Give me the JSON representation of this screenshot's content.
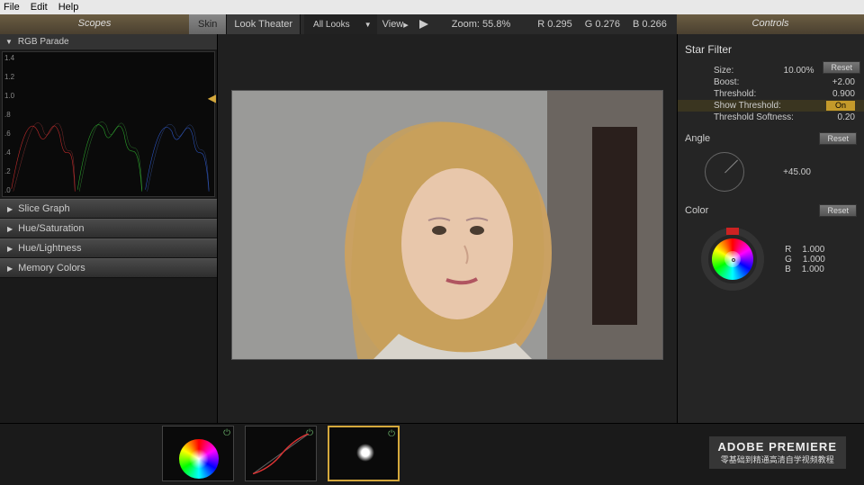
{
  "menu": {
    "file": "File",
    "edit": "Edit",
    "help": "Help"
  },
  "panels": {
    "scopes": "Scopes",
    "controls": "Controls"
  },
  "toolbar": {
    "skin": "Skin",
    "look_theater": "Look Theater",
    "all_looks": "All Looks",
    "view": "View",
    "zoom_label": "Zoom:",
    "zoom_value": "55.8%",
    "r_label": "R",
    "r_val": "0.295",
    "g_label": "G",
    "g_val": "0.276",
    "b_label": "B",
    "b_val": "0.266"
  },
  "scope": {
    "title": "RGB Parade",
    "ticks": [
      "1.4",
      "1.2",
      "1.0",
      ".8",
      ".6",
      ".4",
      ".2",
      ".0"
    ]
  },
  "accordions": [
    "Slice Graph",
    "Hue/Saturation",
    "Hue/Lightness",
    "Memory Colors"
  ],
  "filter": {
    "title": "Star Filter",
    "reset": "Reset",
    "params": [
      {
        "label": "Size:",
        "value": "10.00%"
      },
      {
        "label": "Boost:",
        "value": "+2.00"
      },
      {
        "label": "Threshold:",
        "value": "0.900"
      },
      {
        "label": "Show Threshold:",
        "value": "On",
        "on": true
      },
      {
        "label": "Threshold Softness:",
        "value": "0.20"
      }
    ],
    "angle_label": "Angle",
    "angle_value": "+45.00",
    "color_label": "Color",
    "rgb": [
      {
        "ch": "R",
        "val": "1.000"
      },
      {
        "ch": "G",
        "val": "1.000"
      },
      {
        "ch": "B",
        "val": "1.000"
      }
    ]
  },
  "watermark": {
    "line1": "ADOBE PREMIERE",
    "line2": "零基础到精通高清自学视频教程"
  }
}
